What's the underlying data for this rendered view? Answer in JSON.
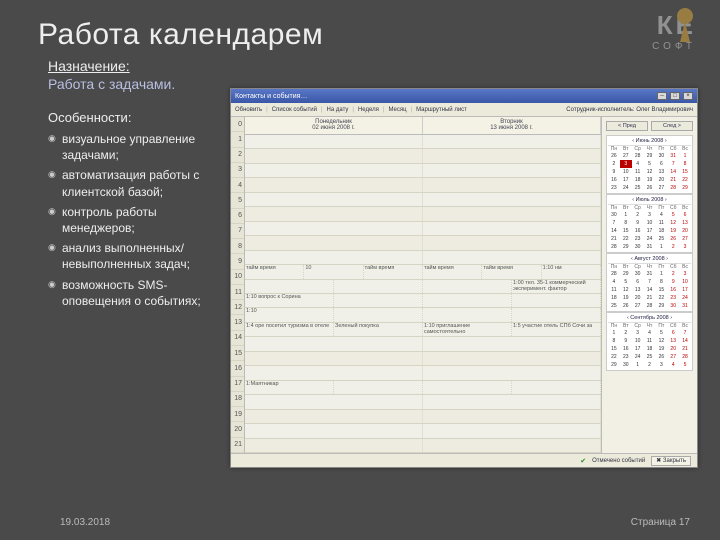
{
  "title": "Работа календарем",
  "purpose_label": "Назначение:",
  "purpose_text": "Работа с задачами.",
  "features_title": "Особенности:",
  "features": [
    "визуальное управление задачами;",
    "автоматизация работы с клиентской базой;",
    "контроль работы менеджеров;",
    "анализ выполненных/ невыполненных задач;",
    "возможность SMS-оповещения о событиях;"
  ],
  "logo": {
    "brand": "КЕ",
    "sub": "СОФТ"
  },
  "footer": {
    "date": "19.03.2018",
    "page": "Страница 17"
  },
  "app": {
    "window_title": "Контакты и события…",
    "toolbar": [
      "Обновить",
      "Список событий",
      "На дату",
      "Неделя",
      "Месяц",
      "Маршрутный лист",
      "Сотрудник-исполнитель: Олег Владимирович"
    ],
    "days": [
      {
        "name": "Понедельник",
        "date": "02 июня 2008 г."
      },
      {
        "name": "Вторник",
        "date": "13 июня 2008 г."
      }
    ],
    "hours": [
      "0",
      "1",
      "2",
      "3",
      "4",
      "5",
      "6",
      "7",
      "8",
      "9",
      "10",
      "11",
      "12",
      "13",
      "14",
      "15",
      "16",
      "17",
      "18",
      "19",
      "20",
      "21"
    ],
    "events": {
      "9": [
        "тайм время",
        "10",
        "тайм время",
        "тайм время",
        "тайм время",
        "1:10 нм"
      ],
      "10": [
        "",
        "",
        "",
        "1:00 тел. 35-1 коммерческий эксперимент. фактор"
      ],
      "11": [
        "1:10 вопрос к Сорина",
        "",
        "",
        ""
      ],
      "12": [
        "1:10",
        "",
        "",
        ""
      ],
      "13": [
        "1:4 оре посетил туризма в отеле",
        "Зеленый покупка",
        "1:10 приглашение самостоятельно",
        "1:5 участие отель СПб Сочи за"
      ],
      "17": [
        "1:Маятникар",
        "",
        "",
        ""
      ]
    },
    "nav": {
      "prev": "< Пред",
      "next": "След >"
    },
    "months": [
      {
        "title": "Июнь 2008",
        "wd": [
          "Пн",
          "Вт",
          "Ср",
          "Чт",
          "Пт",
          "Сб",
          "Вс"
        ],
        "weeks": [
          [
            "26",
            "27",
            "28",
            "29",
            "30",
            "31",
            "1"
          ],
          [
            "2",
            "3",
            "4",
            "5",
            "6",
            "7",
            "8"
          ],
          [
            "9",
            "10",
            "11",
            "12",
            "13",
            "14",
            "15"
          ],
          [
            "16",
            "17",
            "18",
            "19",
            "20",
            "21",
            "22"
          ],
          [
            "23",
            "24",
            "25",
            "26",
            "27",
            "28",
            "29"
          ]
        ],
        "today": "3"
      },
      {
        "title": "Июль 2008",
        "wd": [
          "Пн",
          "Вт",
          "Ср",
          "Чт",
          "Пт",
          "Сб",
          "Вс"
        ],
        "weeks": [
          [
            "30",
            "1",
            "2",
            "3",
            "4",
            "5",
            "6"
          ],
          [
            "7",
            "8",
            "9",
            "10",
            "11",
            "12",
            "13"
          ],
          [
            "14",
            "15",
            "16",
            "17",
            "18",
            "19",
            "20"
          ],
          [
            "21",
            "22",
            "23",
            "24",
            "25",
            "26",
            "27"
          ],
          [
            "28",
            "29",
            "30",
            "31",
            "1",
            "2",
            "3"
          ]
        ]
      },
      {
        "title": "Август 2008",
        "wd": [
          "Пн",
          "Вт",
          "Ср",
          "Чт",
          "Пт",
          "Сб",
          "Вс"
        ],
        "weeks": [
          [
            "28",
            "29",
            "30",
            "31",
            "1",
            "2",
            "3"
          ],
          [
            "4",
            "5",
            "6",
            "7",
            "8",
            "9",
            "10"
          ],
          [
            "11",
            "12",
            "13",
            "14",
            "15",
            "16",
            "17"
          ],
          [
            "18",
            "19",
            "20",
            "21",
            "22",
            "23",
            "24"
          ],
          [
            "25",
            "26",
            "27",
            "28",
            "29",
            "30",
            "31"
          ]
        ]
      },
      {
        "title": "Сентябрь 2008",
        "wd": [
          "Пн",
          "Вт",
          "Ср",
          "Чт",
          "Пт",
          "Сб",
          "Вс"
        ],
        "weeks": [
          [
            "1",
            "2",
            "3",
            "4",
            "5",
            "6",
            "7"
          ],
          [
            "8",
            "9",
            "10",
            "11",
            "12",
            "13",
            "14"
          ],
          [
            "15",
            "16",
            "17",
            "18",
            "19",
            "20",
            "21"
          ],
          [
            "22",
            "23",
            "24",
            "25",
            "26",
            "27",
            "28"
          ],
          [
            "29",
            "30",
            "1",
            "2",
            "3",
            "4",
            "5"
          ]
        ]
      }
    ],
    "status": {
      "flag": "Отмечено событий",
      "close": "Закрыть"
    }
  }
}
